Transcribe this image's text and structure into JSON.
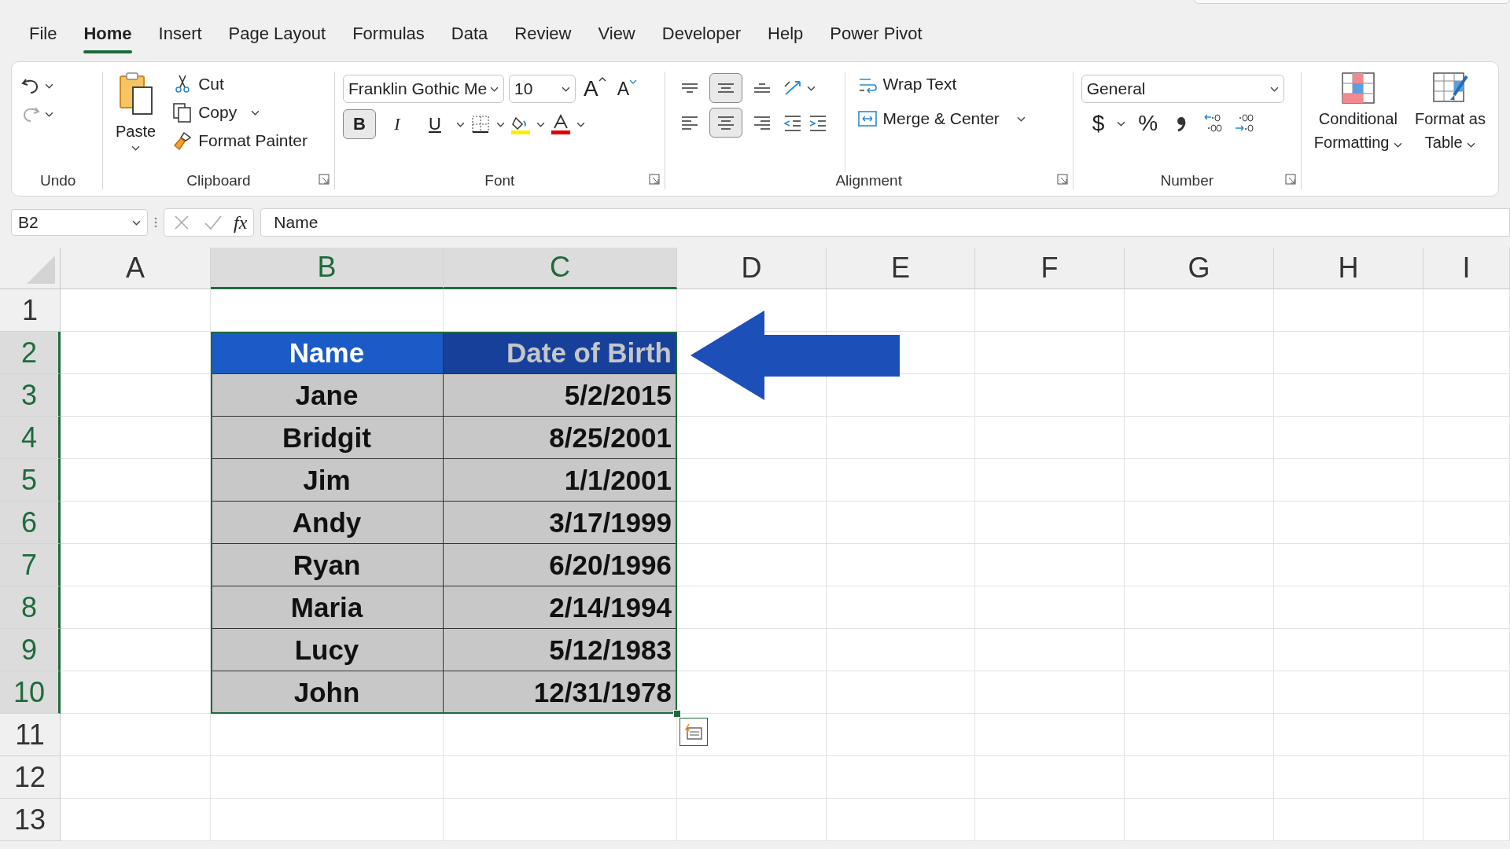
{
  "menu_tabs": [
    {
      "label": "File",
      "selected": false
    },
    {
      "label": "Home",
      "selected": true
    },
    {
      "label": "Insert",
      "selected": false
    },
    {
      "label": "Page Layout",
      "selected": false
    },
    {
      "label": "Formulas",
      "selected": false
    },
    {
      "label": "Data",
      "selected": false
    },
    {
      "label": "Review",
      "selected": false
    },
    {
      "label": "View",
      "selected": false
    },
    {
      "label": "Developer",
      "selected": false
    },
    {
      "label": "Help",
      "selected": false
    },
    {
      "label": "Power Pivot",
      "selected": false
    }
  ],
  "ribbon": {
    "undo": {
      "label": "Undo"
    },
    "clipboard": {
      "paste": "Paste",
      "cut": "Cut",
      "copy": "Copy",
      "format_painter": "Format Painter",
      "label": "Clipboard"
    },
    "font": {
      "font_name": "Franklin Gothic Me",
      "font_size": "10",
      "grow": "A",
      "shrink": "A",
      "toggles": [
        {
          "kind": "bold",
          "label": "B",
          "selected": true
        },
        {
          "kind": "italic",
          "label": "I",
          "selected": false
        },
        {
          "kind": "underline",
          "label": "U",
          "selected": false
        }
      ],
      "label": "Font"
    },
    "alignment": {
      "vertical": [
        {
          "kind": "top",
          "selected": false
        },
        {
          "kind": "middle",
          "selected": true
        },
        {
          "kind": "bottom",
          "selected": false
        }
      ],
      "horizontal": [
        {
          "kind": "left",
          "selected": false
        },
        {
          "kind": "center",
          "selected": true
        },
        {
          "kind": "right",
          "selected": false
        }
      ],
      "wrap_text": "Wrap Text",
      "merge_center": "Merge & Center",
      "label": "Alignment"
    },
    "number": {
      "format": "General",
      "currency": "$",
      "percent": "%",
      "label": "Number"
    },
    "styles": {
      "conditional_formatting": [
        "Conditional",
        "Formatting"
      ],
      "format_as_table": [
        "Format as",
        "Table"
      ]
    }
  },
  "formula_bar": {
    "name_box": "B2",
    "fx": "fx",
    "formula": "Name"
  },
  "columns": [
    {
      "label": "A",
      "selected": false
    },
    {
      "label": "B",
      "selected": true
    },
    {
      "label": "C",
      "selected": true
    },
    {
      "label": "D",
      "selected": false
    },
    {
      "label": "E",
      "selected": false
    },
    {
      "label": "F",
      "selected": false
    },
    {
      "label": "G",
      "selected": false
    },
    {
      "label": "H",
      "selected": false
    },
    {
      "label": "I",
      "selected": false
    }
  ],
  "rows": [
    {
      "label": "1",
      "selected": false
    },
    {
      "label": "2",
      "selected": true
    },
    {
      "label": "3",
      "selected": true
    },
    {
      "label": "4",
      "selected": true
    },
    {
      "label": "5",
      "selected": true
    },
    {
      "label": "6",
      "selected": true
    },
    {
      "label": "7",
      "selected": true
    },
    {
      "label": "8",
      "selected": true
    },
    {
      "label": "9",
      "selected": true
    },
    {
      "label": "10",
      "selected": true
    },
    {
      "label": "11",
      "selected": false
    },
    {
      "label": "12",
      "selected": false
    },
    {
      "label": "13",
      "selected": false
    }
  ],
  "table": {
    "header": [
      "Name",
      "Date of Birth"
    ],
    "rows": [
      [
        "Jane",
        "5/2/2015"
      ],
      [
        "Bridgit",
        "8/25/2001"
      ],
      [
        "Jim",
        "1/1/2001"
      ],
      [
        "Andy",
        "3/17/1999"
      ],
      [
        "Ryan",
        "6/20/1996"
      ],
      [
        "Maria",
        "2/14/1994"
      ],
      [
        "Lucy",
        "5/12/1983"
      ],
      [
        "John",
        "12/31/1978"
      ]
    ]
  }
}
